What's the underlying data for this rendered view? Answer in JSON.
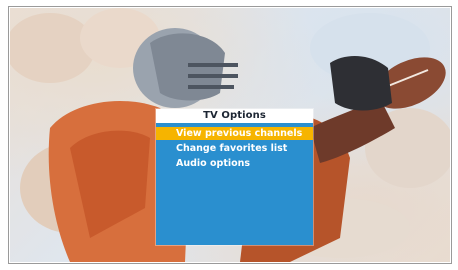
{
  "menu": {
    "title": "TV Options",
    "items": [
      {
        "label": "View previous channels",
        "selected": true
      },
      {
        "label": "Change favorites list",
        "selected": false
      },
      {
        "label": "Audio options",
        "selected": false
      }
    ]
  },
  "colors": {
    "menu_background": "#2a8fcf",
    "menu_highlight": "#f6b400",
    "menu_title_background": "#ffffff"
  }
}
